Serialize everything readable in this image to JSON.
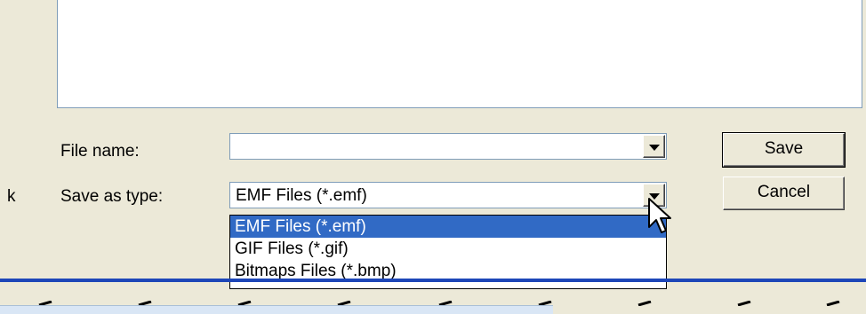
{
  "left_partial_text": "k",
  "file_name": {
    "label": "File name:",
    "value": ""
  },
  "save_as_type": {
    "label": "Save as type:",
    "selected": "EMF Files (*.emf)",
    "options": [
      "EMF Files (*.emf)",
      "GIF Files (*.gif)",
      "Bitmaps Files (*.bmp)"
    ]
  },
  "buttons": {
    "save": "Save",
    "cancel": "Cancel"
  },
  "colors": {
    "selection": "#316ac5",
    "accent_line": "#1d46b8"
  }
}
